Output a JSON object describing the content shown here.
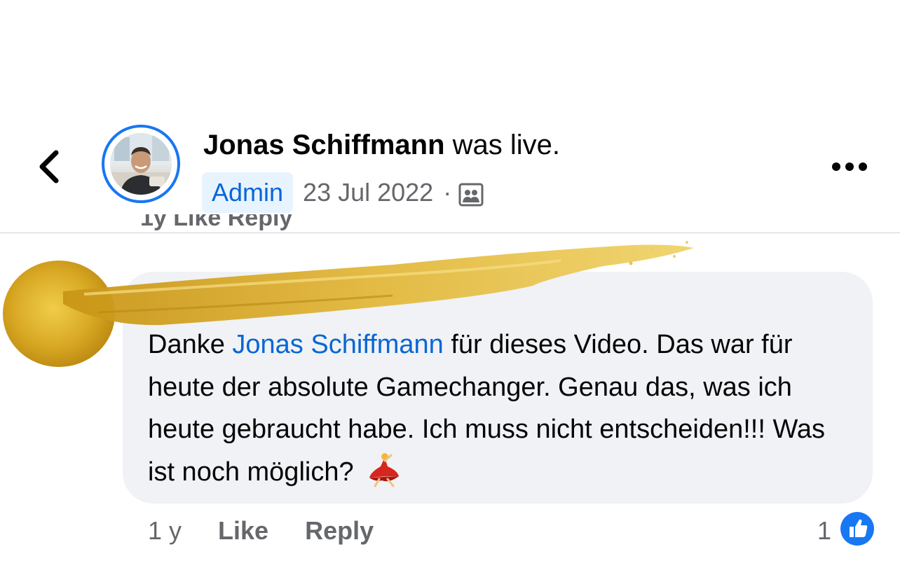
{
  "header": {
    "author_name": "Jonas Schiffmann",
    "action_text": " was live.",
    "badge": "Admin",
    "date": "23 Jul 2022",
    "separator": "·",
    "audience_icon": "group-icon"
  },
  "previous_comment_actions": "1y    Like    Reply",
  "comment": {
    "prefix": "Danke ",
    "mention": "Jonas Schiffmann",
    "body": " für dieses Video. Das war für heute der absolute Gamechanger. Genau das, was ich heute gebraucht habe. Ich muss nicht entscheiden!!! Was ist noch möglich? ",
    "emoji": "woman-dancing-emoji"
  },
  "actions": {
    "time": "1 y",
    "like": "Like",
    "reply": "Reply",
    "reaction_count": "1",
    "reaction_icon": "like-reaction-icon"
  },
  "colors": {
    "accent": "#1877f2",
    "link": "#0866d5",
    "bubble": "#f0f2f5",
    "secondary_text": "#65676b",
    "gold_overlay": "#d4a82a"
  }
}
